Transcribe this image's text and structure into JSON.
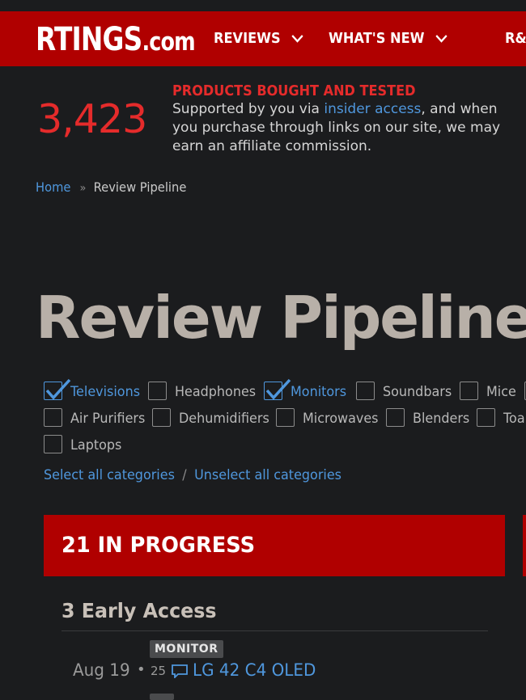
{
  "header": {
    "logo_main": "RTINGS",
    "logo_suffix": ".com",
    "nav": [
      {
        "label": "REVIEWS"
      },
      {
        "label": "WHAT'S NEW"
      },
      {
        "label": "R&"
      }
    ]
  },
  "stats": {
    "count": "3,423",
    "heading": "PRODUCTS BOUGHT AND TESTED",
    "text_before": "Supported by you via ",
    "link": "insider access",
    "text_after": ", and when you purchase through links on our site, we may earn an affiliate commission."
  },
  "breadcrumb": {
    "home": "Home",
    "separator": "»",
    "current": "Review Pipeline"
  },
  "page_title": "Review Pipeline",
  "categories": [
    {
      "label": "Televisions",
      "checked": true
    },
    {
      "label": "Headphones",
      "checked": false
    },
    {
      "label": "Monitors",
      "checked": true
    },
    {
      "label": "Soundbars",
      "checked": false
    },
    {
      "label": "Mice",
      "checked": false
    },
    {
      "label": "Air Purifiers",
      "checked": false
    },
    {
      "label": "Dehumidifiers",
      "checked": false
    },
    {
      "label": "Microwaves",
      "checked": false
    },
    {
      "label": "Blenders",
      "checked": false
    },
    {
      "label": "Toa",
      "checked": false
    },
    {
      "label": "Laptops",
      "checked": false
    }
  ],
  "select_links": {
    "select_all": "Select all categories",
    "separator": "/",
    "unselect_all": "Unselect all categories"
  },
  "progress": {
    "banner": "21 IN PROGRESS",
    "section": "3 Early Access",
    "items": [
      {
        "badge": "MONITOR",
        "date": "Aug 19",
        "dot": "•",
        "comments": "25",
        "name": "LG 42 C4 OLED"
      }
    ]
  },
  "colors": {
    "brand_red": "#b00000",
    "accent_red": "#e52b2b",
    "link_blue": "#4f97dd",
    "background": "#1b1c1e"
  }
}
